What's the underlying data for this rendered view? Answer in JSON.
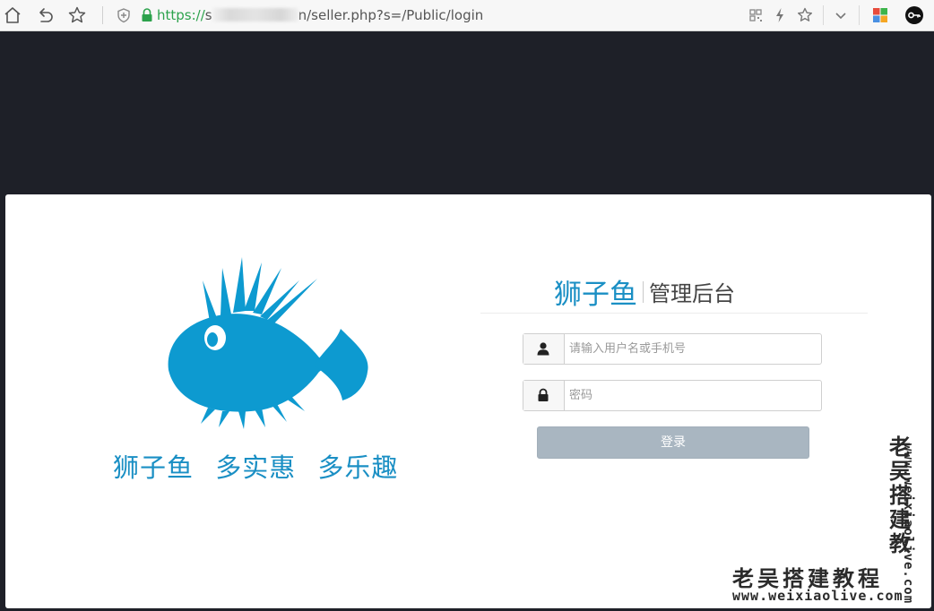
{
  "browser": {
    "url_scheme": "https://",
    "url_prefix": "s",
    "url_suffix": "n/seller.php?s=/Public/login",
    "icons": [
      "home-icon",
      "back-icon",
      "bookmark-star-icon",
      "shield-icon",
      "lock-icon",
      "qr-code-icon",
      "lightning-icon",
      "favorites-icon",
      "chevron-down-icon",
      "apps-icon",
      "key-icon"
    ]
  },
  "login": {
    "brand": "狮子鱼",
    "subtitle": "管理后台",
    "slogan": "狮子鱼 多实惠 多乐趣",
    "username_placeholder": "请输入用户名或手机号",
    "password_placeholder": "密码",
    "submit_label": "登录",
    "brand_color": "#1a8fc4",
    "button_color": "#a9b6c1"
  },
  "watermark": {
    "text": "老吴搭建教程",
    "url": "www.weixiaolive.com",
    "vertical_text": "老吴搭建教",
    "vertical_url": "www.weixiaolive.com"
  }
}
